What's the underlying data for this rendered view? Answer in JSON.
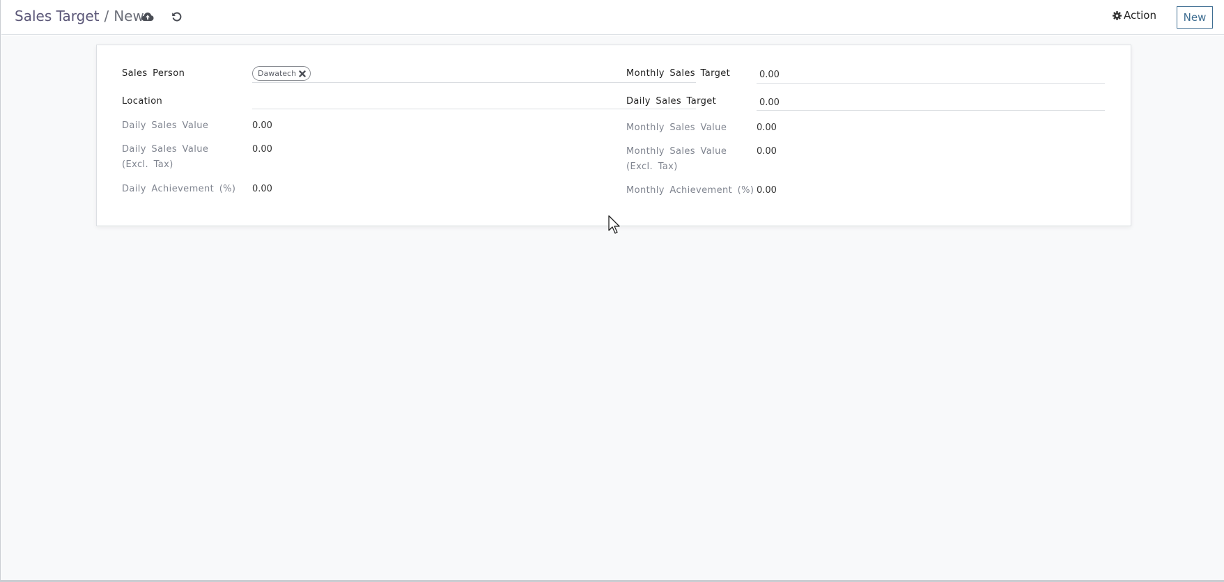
{
  "breadcrumb": {
    "parent": "Sales Target",
    "separator": "/",
    "current": "New"
  },
  "toolbar": {
    "save_icon": "cloud-upload-icon",
    "discard_icon": "undo-icon",
    "action_label": "Action",
    "action_icon": "gear-icon",
    "new_label": "New"
  },
  "form": {
    "left": {
      "sales_person_label": "Sales Person",
      "sales_person_tag": "Dawatech",
      "location_label": "Location",
      "location_value": "",
      "daily_sales_value_label": "Daily Sales Value",
      "daily_sales_value": "0.00",
      "daily_sales_value_excl_label": "Daily Sales Value (Excl. Tax)",
      "daily_sales_value_excl": "0.00",
      "daily_achievement_label": "Daily Achievement (%)",
      "daily_achievement": "0.00"
    },
    "right": {
      "monthly_sales_target_label": "Monthly Sales Target",
      "monthly_sales_target": "0.00",
      "daily_sales_target_label": "Daily Sales Target",
      "daily_sales_target": "0.00",
      "monthly_sales_value_label": "Monthly Sales Value",
      "monthly_sales_value": "0.00",
      "monthly_sales_value_excl_label": "Monthly Sales Value (Excl. Tax)",
      "monthly_sales_value_excl": "0.00",
      "monthly_achievement_label": "Monthly Achievement (%)",
      "monthly_achievement": "0.00"
    }
  },
  "colors": {
    "primary": "#3f6e92",
    "breadcrumb": "#5a5677",
    "muted_label": "#808590",
    "background": "#f8f9fa"
  }
}
